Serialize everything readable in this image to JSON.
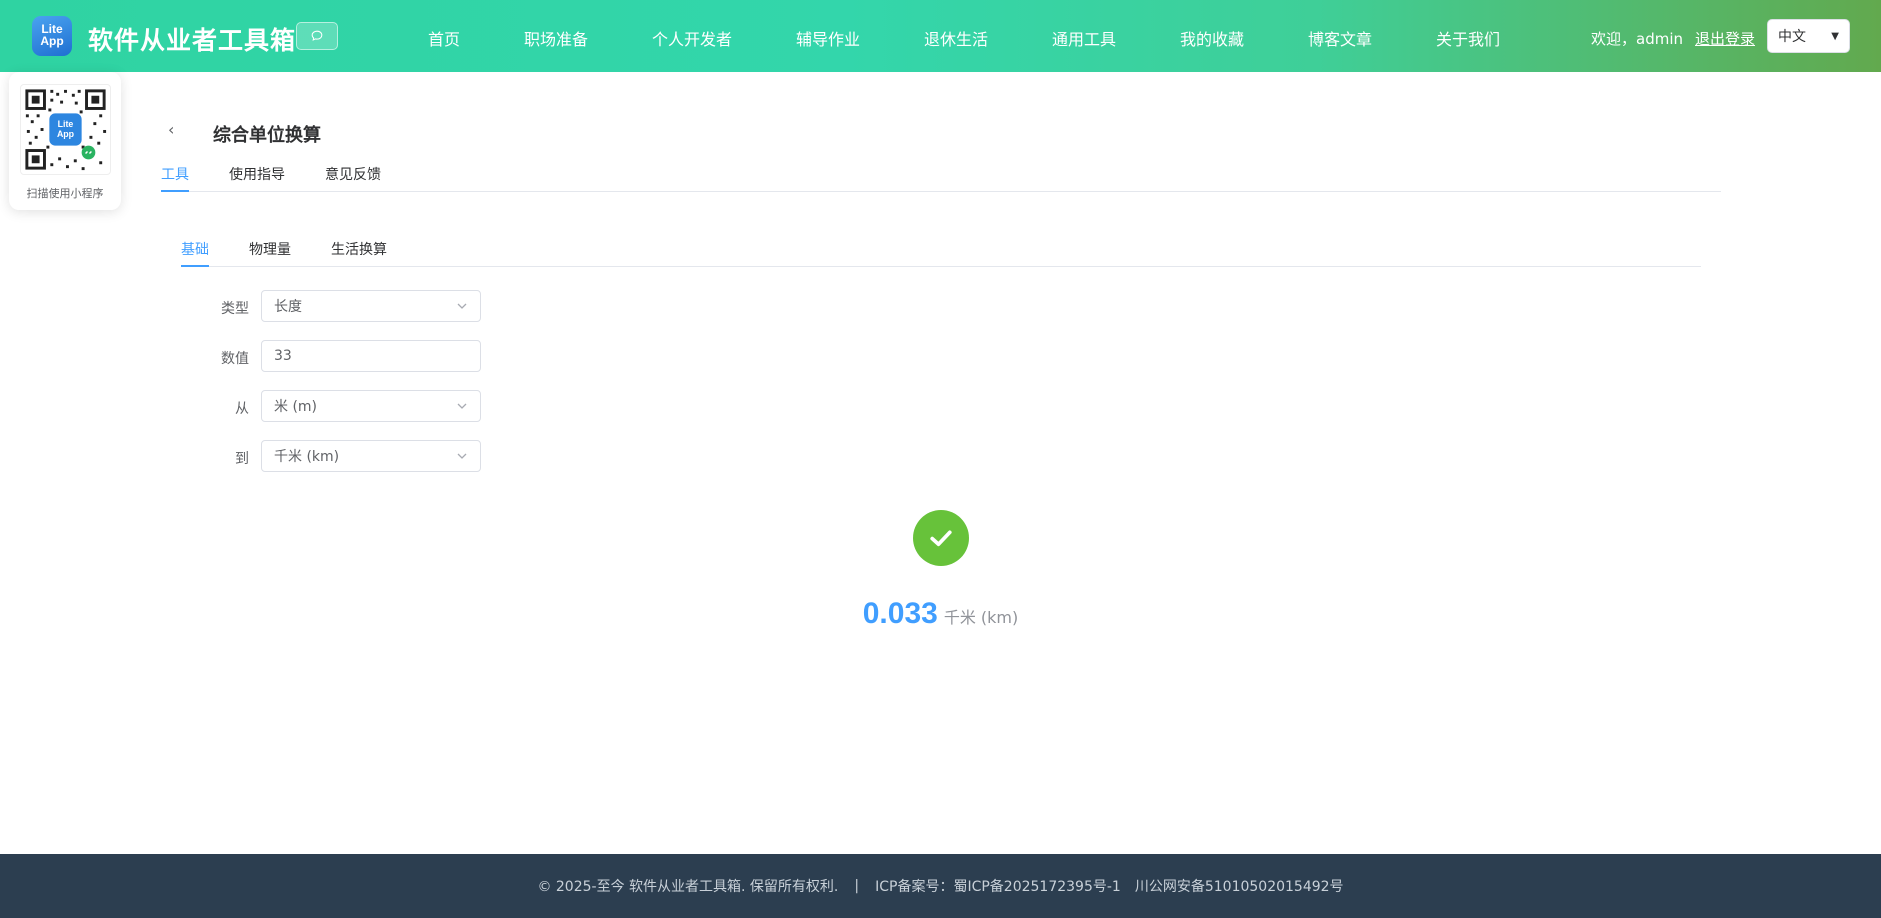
{
  "header": {
    "logo_line1": "Lite",
    "logo_line2": "App",
    "site_title": "软件从业者工具箱",
    "nav": [
      "首页",
      "职场准备",
      "个人开发者",
      "辅导作业",
      "退休生活",
      "通用工具",
      "我的收藏",
      "博客文章",
      "关于我们"
    ],
    "welcome": "欢迎，admin",
    "logout": "退出登录",
    "language": "中文"
  },
  "qr": {
    "caption": "扫描使用小程序"
  },
  "page": {
    "title": "综合单位换算",
    "tabs": [
      "工具",
      "使用指导",
      "意见反馈"
    ],
    "sub_tabs": [
      "基础",
      "物理量",
      "生活换算"
    ]
  },
  "form": {
    "type_label": "类型",
    "type_value": "长度",
    "value_label": "数值",
    "value_value": "33",
    "from_label": "从",
    "from_value": "米 (m)",
    "to_label": "到",
    "to_value": "千米 (km)"
  },
  "result": {
    "value": "0.033",
    "unit": "千米 (km)"
  },
  "footer": {
    "copyright": "© 2025-至今 软件从业者工具箱. 保留所有权利.",
    "separator": "|",
    "icp": "ICP备案号：蜀ICP备2025172395号-1",
    "police": "川公网安备51010502015492号"
  },
  "colors": {
    "accent": "#409eff",
    "success": "#67c23a",
    "footer_bg": "#2c3e50",
    "header_start": "#2fd3a2",
    "header_end": "#62a94e"
  }
}
